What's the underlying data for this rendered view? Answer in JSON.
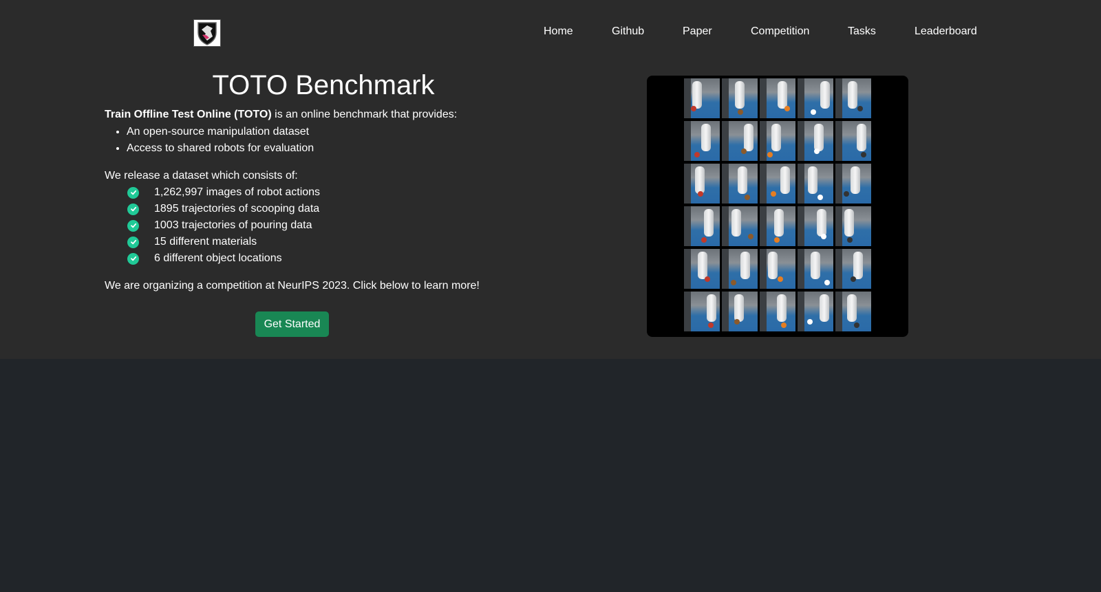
{
  "header": {
    "logo_alt": "TOTO logo",
    "nav": [
      "Home",
      "Github",
      "Paper",
      "Competition",
      "Tasks",
      "Leaderboard"
    ]
  },
  "hero": {
    "title": "TOTO Benchmark",
    "intro_bold": "Train Offline Test Online (TOTO)",
    "intro_rest": " is an online benchmark that provides:",
    "provides": [
      "An open-source manipulation dataset",
      "Access to shared robots for evaluation"
    ],
    "release_heading": "We release a dataset which consists of:",
    "dataset_items": [
      "1,262,997 images of robot actions",
      "1895 trajectories of scooping data",
      "1003 trajectories of pouring data",
      "15 different materials",
      "6 different object locations"
    ],
    "competition_text": "We are organizing a competition at NeurIPS 2023. Click below to learn more!",
    "cta_label": "Get Started"
  },
  "colors": {
    "header_bg": "#2b2b2b",
    "page_bg": "#212529",
    "nav_text": "#a9a9a9",
    "check": "#20c997",
    "button": "#198754"
  },
  "icons": {
    "logo": "shield-logo-icon",
    "check": "check-circle-icon"
  }
}
